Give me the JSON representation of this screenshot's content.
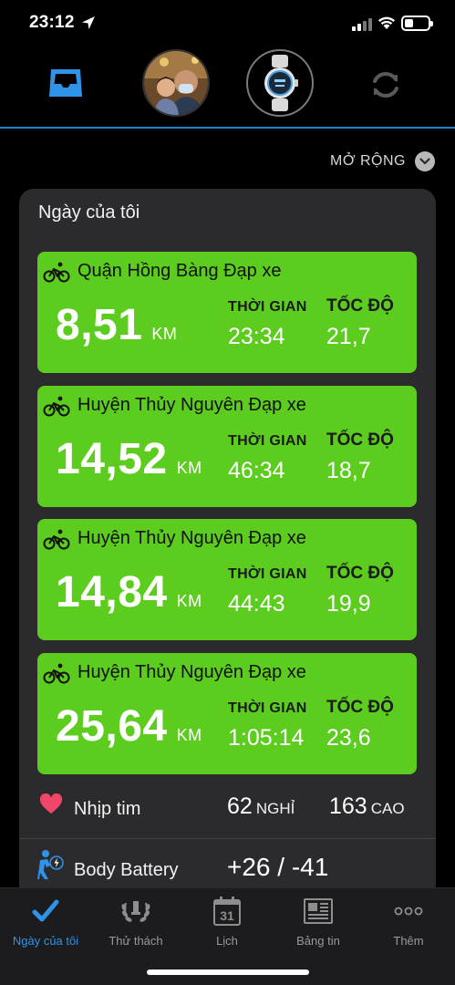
{
  "status_bar": {
    "time": "23:12"
  },
  "header": {
    "expand_label": "MỞ RỘNG"
  },
  "my_day": {
    "title": "Ngày của tôi",
    "activities": [
      {
        "name": "Quận Hồng Bàng Đạp xe",
        "distance": "8,51",
        "distance_unit": "KM",
        "time_label": "THỜI GIAN",
        "time": "23:34",
        "speed_label": "TỐC ĐỘ",
        "speed": "21,7"
      },
      {
        "name": "Huyện Thủy Nguyên Đạp xe",
        "distance": "14,52",
        "distance_unit": "KM",
        "time_label": "THỜI GIAN",
        "time": "46:34",
        "speed_label": "TỐC ĐỘ",
        "speed": "18,7"
      },
      {
        "name": "Huyện Thủy Nguyên Đạp xe",
        "distance": "14,84",
        "distance_unit": "KM",
        "time_label": "THỜI GIAN",
        "time": "44:43",
        "speed_label": "TỐC ĐỘ",
        "speed": "19,9"
      },
      {
        "name": "Huyện Thủy Nguyên Đạp xe",
        "distance": "25,64",
        "distance_unit": "KM",
        "time_label": "THỜI GIAN",
        "time": "1:05:14",
        "speed_label": "TỐC ĐỘ",
        "speed": "23,6"
      }
    ],
    "heart_rate": {
      "label": "Nhịp tim",
      "resting": "62",
      "resting_unit": "NGHỈ",
      "high": "163",
      "high_unit": "CAO"
    },
    "body_battery": {
      "label": "Body Battery",
      "value": "+26 / -41"
    }
  },
  "tabs": [
    {
      "label": "Ngày của tôi",
      "icon": "check-icon",
      "active": true
    },
    {
      "label": "Thử thách",
      "icon": "laurel-icon",
      "active": false
    },
    {
      "label": "Lịch",
      "icon": "calendar-icon",
      "active": false,
      "icon_text": "31"
    },
    {
      "label": "Bảng tin",
      "icon": "newsfeed-icon",
      "active": false
    },
    {
      "label": "Thêm",
      "icon": "more-icon",
      "active": false
    }
  ],
  "colors": {
    "accent": "#2f93e8",
    "activity_green": "#5ccc1e",
    "card_bg": "#2b2b2d",
    "heart": "#f0466a"
  }
}
